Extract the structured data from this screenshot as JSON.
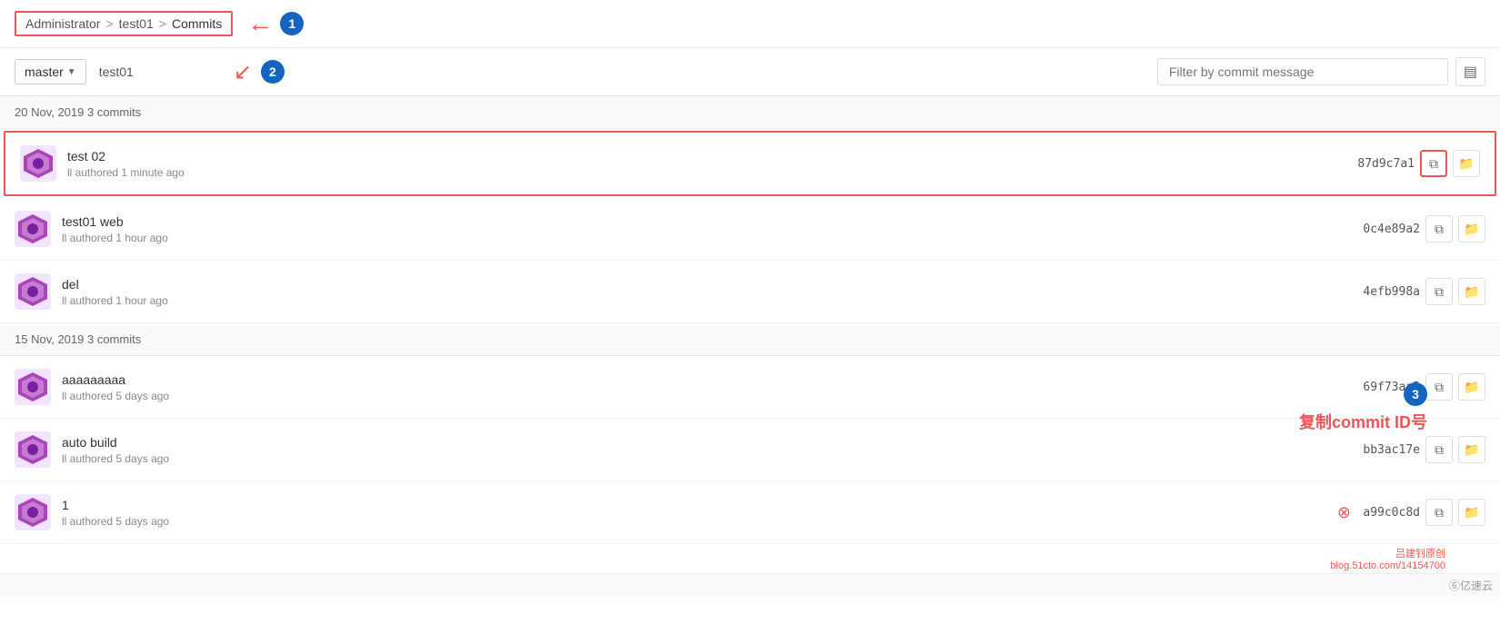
{
  "breadcrumb": {
    "admin": "Administrator",
    "sep1": ">",
    "repo": "test01",
    "sep2": ">",
    "current": "Commits"
  },
  "toolbar": {
    "branch": "master",
    "repo_name": "test01",
    "filter_placeholder": "Filter by commit message"
  },
  "date_groups": [
    {
      "label": "20 Nov, 2019 3 commits",
      "commits": [
        {
          "id": "c1",
          "title": "test 02",
          "meta": "ll authored 1 minute ago",
          "hash": "87d9c7a1",
          "highlighted": true,
          "has_x": false
        },
        {
          "id": "c2",
          "title": "test01 web",
          "meta": "ll authored 1 hour ago",
          "hash": "0c4e89a2",
          "highlighted": false,
          "has_x": false
        },
        {
          "id": "c3",
          "title": "del",
          "meta": "ll authored 1 hour ago",
          "hash": "4efb998a",
          "highlighted": false,
          "has_x": false
        }
      ]
    },
    {
      "label": "15 Nov, 2019 3 commits",
      "commits": [
        {
          "id": "c4",
          "title": "aaaaaaaaa",
          "meta": "ll authored 5 days ago",
          "hash": "69f73aa5",
          "highlighted": false,
          "has_x": false
        },
        {
          "id": "c5",
          "title": "auto build",
          "meta": "ll authored 5 days ago",
          "hash": "bb3ac17e",
          "highlighted": false,
          "has_x": false
        },
        {
          "id": "c6",
          "title": "1",
          "meta": "ll authored 5 days ago",
          "hash": "a99c0c8d",
          "highlighted": false,
          "has_x": true
        }
      ]
    }
  ],
  "annotations": {
    "circle1": "1",
    "circle2": "2",
    "circle3": "3",
    "chinese_label": "复制commit ID号"
  },
  "watermark": "吕建钊原创",
  "blog": "blog.51cto.com/14154700",
  "yiyun": "⑥亿速云"
}
